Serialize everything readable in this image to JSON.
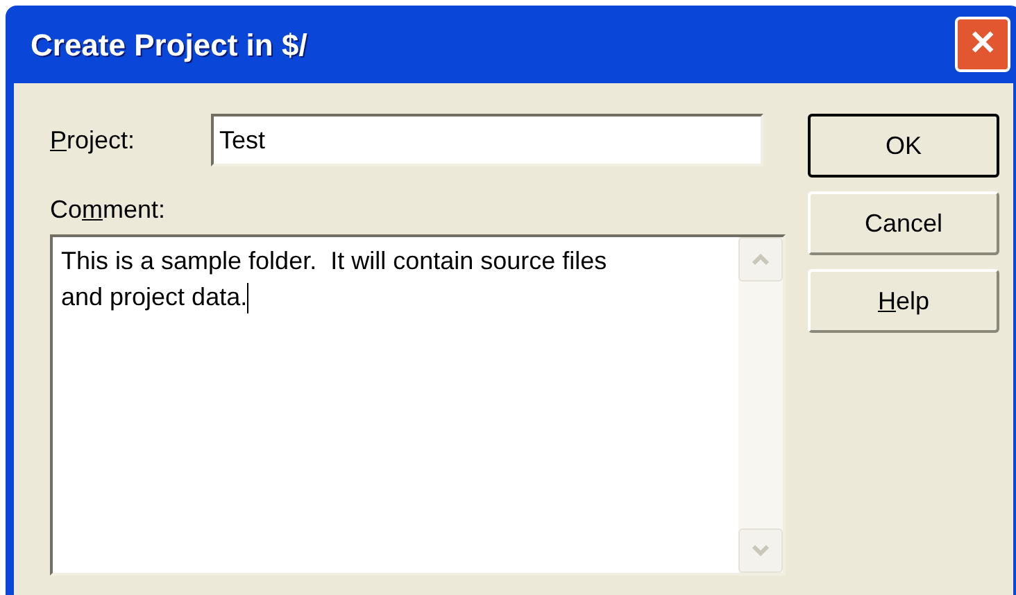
{
  "window": {
    "title": "Create Project in $/",
    "close": "✕"
  },
  "project": {
    "label": {
      "key": "P",
      "after": "roject:"
    },
    "value": "Test"
  },
  "comment": {
    "label": {
      "before": "Co",
      "key": "m",
      "after": "ment:"
    },
    "value": "This is a sample folder.  It will contain source files\nand project data.",
    "caret": true
  },
  "buttons": [
    {
      "after": "OK",
      "default": true
    },
    {
      "after": "Cancel",
      "default": false
    },
    {
      "key": "H",
      "after": "elp",
      "default": false
    }
  ]
}
